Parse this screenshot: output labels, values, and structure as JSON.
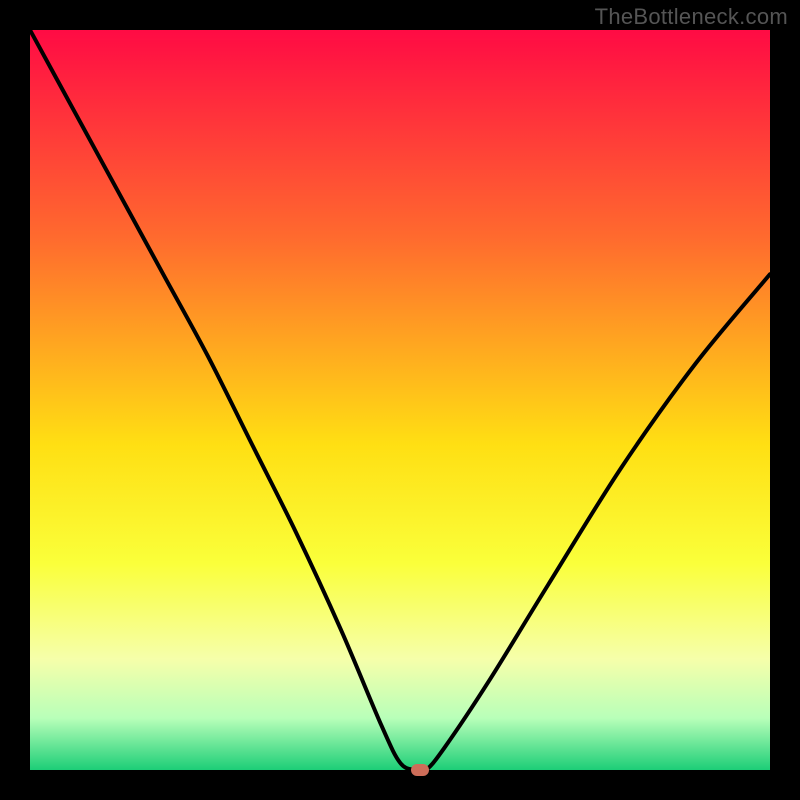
{
  "watermark": "TheBottleneck.com",
  "colors": {
    "frame": "#000000",
    "gradient_top": "#ff0b44",
    "gradient_mid1": "#ff6a2e",
    "gradient_mid2": "#ffdf13",
    "gradient_mid3": "#faff3a",
    "gradient_mid4": "#f6ffaa",
    "gradient_mid5": "#b8ffb9",
    "gradient_bottom": "#1cce77",
    "curve": "#000000",
    "marker": "#cd6d59"
  },
  "chart_data": {
    "type": "line",
    "title": "",
    "xlabel": "",
    "ylabel": "",
    "xlim": [
      0,
      100
    ],
    "ylim": [
      0,
      100
    ],
    "series": [
      {
        "name": "bottleneck-curve",
        "x": [
          0,
          6,
          12,
          18,
          24,
          30,
          36,
          42,
          47.5,
          50,
          52,
          53.5,
          56,
          62,
          70,
          80,
          90,
          100
        ],
        "y": [
          100,
          89,
          78,
          67,
          56,
          44,
          32,
          19,
          6,
          1,
          0,
          0,
          3,
          12,
          25,
          41,
          55,
          67
        ]
      }
    ],
    "marker": {
      "x": 52.7,
      "y": 0,
      "shape": "rounded-rect"
    },
    "gradient_stops": [
      {
        "pos": 0.0,
        "color": "#ff0b44"
      },
      {
        "pos": 0.28,
        "color": "#ff6a2e"
      },
      {
        "pos": 0.56,
        "color": "#ffdf13"
      },
      {
        "pos": 0.72,
        "color": "#faff3a"
      },
      {
        "pos": 0.85,
        "color": "#f6ffaa"
      },
      {
        "pos": 0.93,
        "color": "#b8ffb9"
      },
      {
        "pos": 1.0,
        "color": "#1cce77"
      }
    ]
  }
}
